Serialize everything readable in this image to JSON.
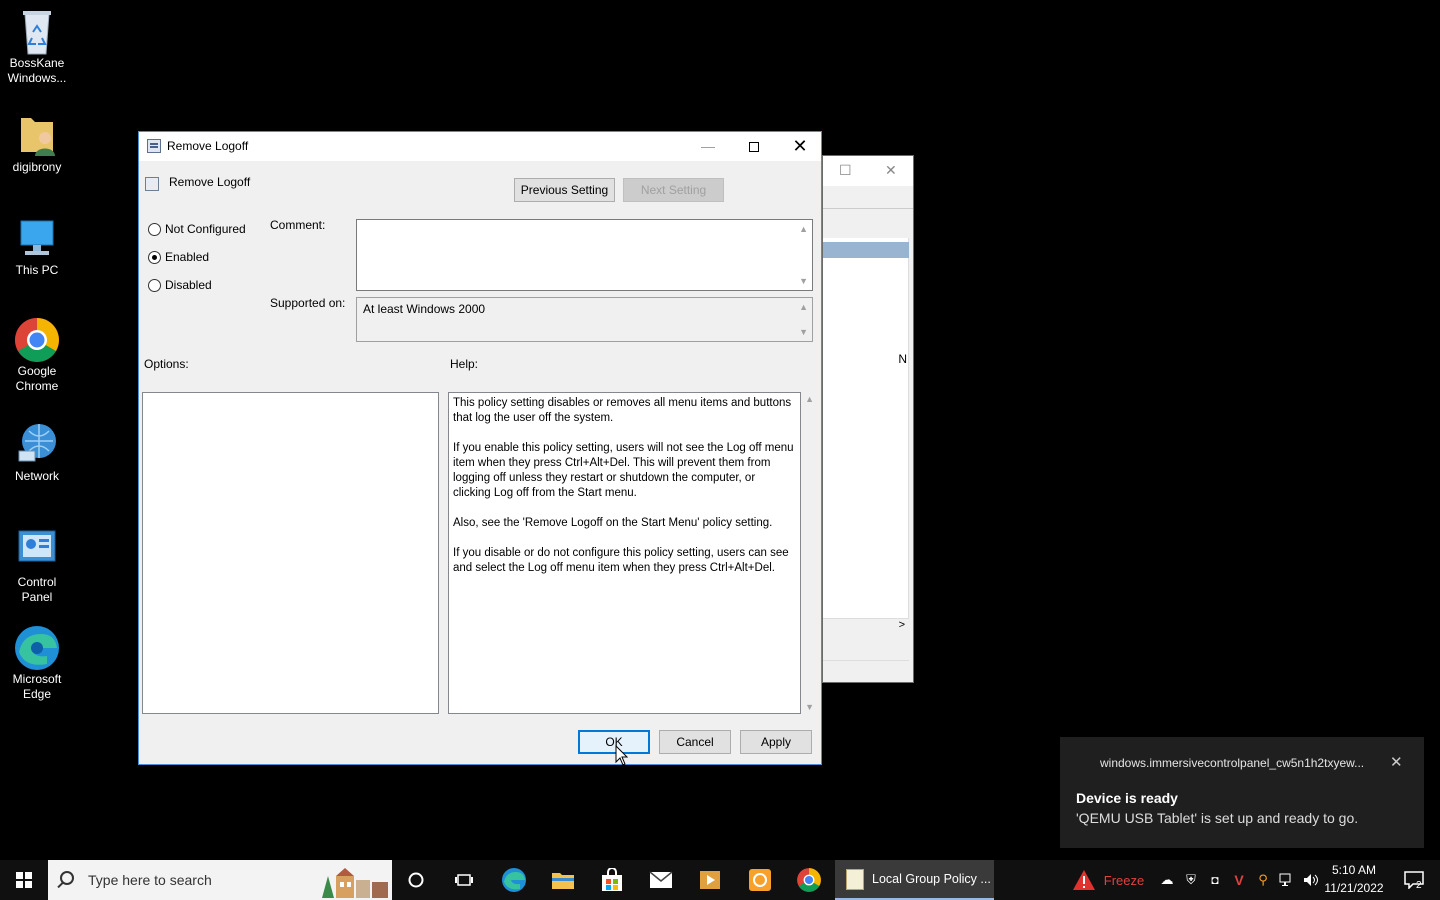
{
  "desktop": {
    "icons": [
      {
        "label": "BossKane Windows...",
        "icon": "recycle-bin-icon"
      },
      {
        "label": "digibrony",
        "icon": "user-folder-icon"
      },
      {
        "label": "This PC",
        "icon": "computer-icon"
      },
      {
        "label": "Google Chrome",
        "icon": "chrome-icon"
      },
      {
        "label": "Network",
        "icon": "network-icon"
      },
      {
        "label": "Control Panel",
        "icon": "control-panel-icon"
      },
      {
        "label": "Microsoft Edge",
        "icon": "edge-icon"
      }
    ]
  },
  "background_window": {
    "column_header": "N"
  },
  "dialog": {
    "title": "Remove Logoff",
    "setting_name": "Remove Logoff",
    "previous_setting": "Previous Setting",
    "next_setting": "Next Setting",
    "radio": {
      "not_configured": "Not Configured",
      "enabled": "Enabled",
      "disabled": "Disabled",
      "selected": "Enabled"
    },
    "comment_label": "Comment:",
    "comment_value": "",
    "supported_label": "Supported on:",
    "supported_value": "At least Windows 2000",
    "options_label": "Options:",
    "help_label": "Help:",
    "help_paragraphs": [
      "This policy setting disables or removes all menu items and buttons that log the user off the system.",
      "If you enable this policy setting, users will not see the Log off menu item when they press Ctrl+Alt+Del. This will prevent them from logging off unless they restart or shutdown the computer, or clicking Log off from the Start menu.",
      "Also, see the 'Remove Logoff on the Start Menu' policy setting.",
      "If you disable or do not configure this policy setting, users can see and select the Log off menu item when they press Ctrl+Alt+Del."
    ],
    "ok": "OK",
    "cancel": "Cancel",
    "apply": "Apply"
  },
  "notification": {
    "app": "windows.immersivecontrolpanel_cw5n1h2txyew...",
    "title": "Device is ready",
    "body": "'QEMU USB Tablet' is set up and ready to go."
  },
  "taskbar": {
    "search_placeholder": "Type here to search",
    "active_app": "Local Group Policy ...",
    "freeze_label": "Freeze",
    "time": "5:10 AM",
    "date": "11/21/2022",
    "notification_count": "2"
  }
}
